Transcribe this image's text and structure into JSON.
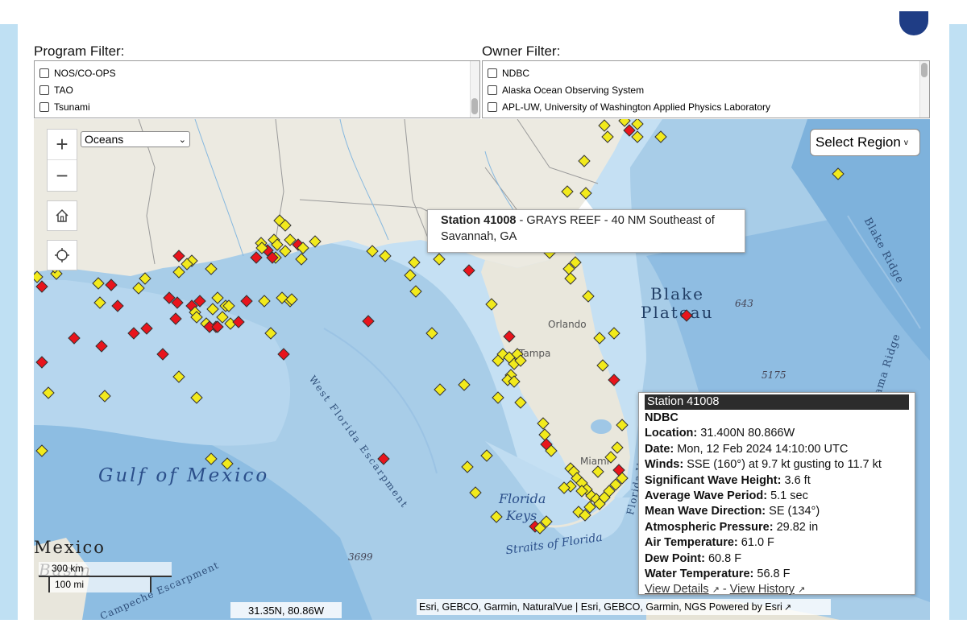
{
  "program_filter": {
    "label": "Program Filter:",
    "options": [
      "NOS/CO-OPS",
      "TAO",
      "Tsunami"
    ]
  },
  "owner_filter": {
    "label": "Owner Filter:",
    "options": [
      "NDBC",
      "Alaska Ocean Observing System",
      "APL-UW, University of Washington Applied Physics Laboratory"
    ]
  },
  "map_controls": {
    "zoom_in": "+",
    "zoom_out": "−",
    "basemap_selected": "Oceans",
    "select_region_label": "Select Region",
    "select_region_chevron": "v"
  },
  "hover_tooltip": {
    "station": "Station 41008",
    "description": " - GRAYS REEF - 40 NM Southeast of Savannah, GA"
  },
  "popup": {
    "title": "Station 41008",
    "owner": "NDBC",
    "rows": [
      {
        "label": "Location:",
        "value": " 31.400N 80.866W"
      },
      {
        "label": "Date:",
        "value": " Mon, 12 Feb 2024 14:10:00 UTC"
      },
      {
        "label": "Winds:",
        "value": " SSE (160°) at 9.7 kt gusting to 11.7 kt"
      },
      {
        "label": "Significant Wave Height:",
        "value": " 3.6 ft"
      },
      {
        "label": "Average Wave Period:",
        "value": " 5.1 sec"
      },
      {
        "label": "Mean Wave Direction:",
        "value": " SE (134°)"
      },
      {
        "label": "Atmospheric Pressure:",
        "value": " 29.82 in"
      },
      {
        "label": "Air Temperature:",
        "value": " 61.0 F"
      },
      {
        "label": "Dew Point:",
        "value": " 60.8 F"
      },
      {
        "label": "Water Temperature:",
        "value": " 56.8 F"
      }
    ],
    "view_details": "View Details",
    "separator": " - ",
    "view_history": "View History"
  },
  "scale": {
    "km": "300 km",
    "mi": "100 mi"
  },
  "coordinates": "31.35N, 80.86W",
  "attribution": "Esri, GEBCO, Garmin, NaturalVue | Esri, GEBCO, Garmin, NGS Powered by Esri",
  "map_labels": {
    "gulf": "Gulf of Mexico",
    "west_florida_escarpment": "West Florida Escarpment",
    "florida_keys_1": "Florida",
    "florida_keys_2": "Keys",
    "straits": "Straits of Florida",
    "blake_plateau_1": "Blake",
    "blake_plateau_2": "Plateau",
    "blake_ridge": "Blake Ridge",
    "bahama_ridge": "ama Ridge",
    "florida_valley": "Florida Valley",
    "campeche": "Campeche Escarpment",
    "mexico": "Mexico",
    "basin": "Basin",
    "orlando": "Orlando",
    "tampa": "Tampa",
    "miami": "Miami",
    "depth_643": "643",
    "depth_5175": "5175",
    "depth_3699": "3699"
  },
  "colors": {
    "station_yellow": "#f2ea1c",
    "station_red": "#e8141c",
    "land": "#efece4",
    "shelf_water": "#bcdaf0",
    "deep_water": "#7fb0dc"
  }
}
